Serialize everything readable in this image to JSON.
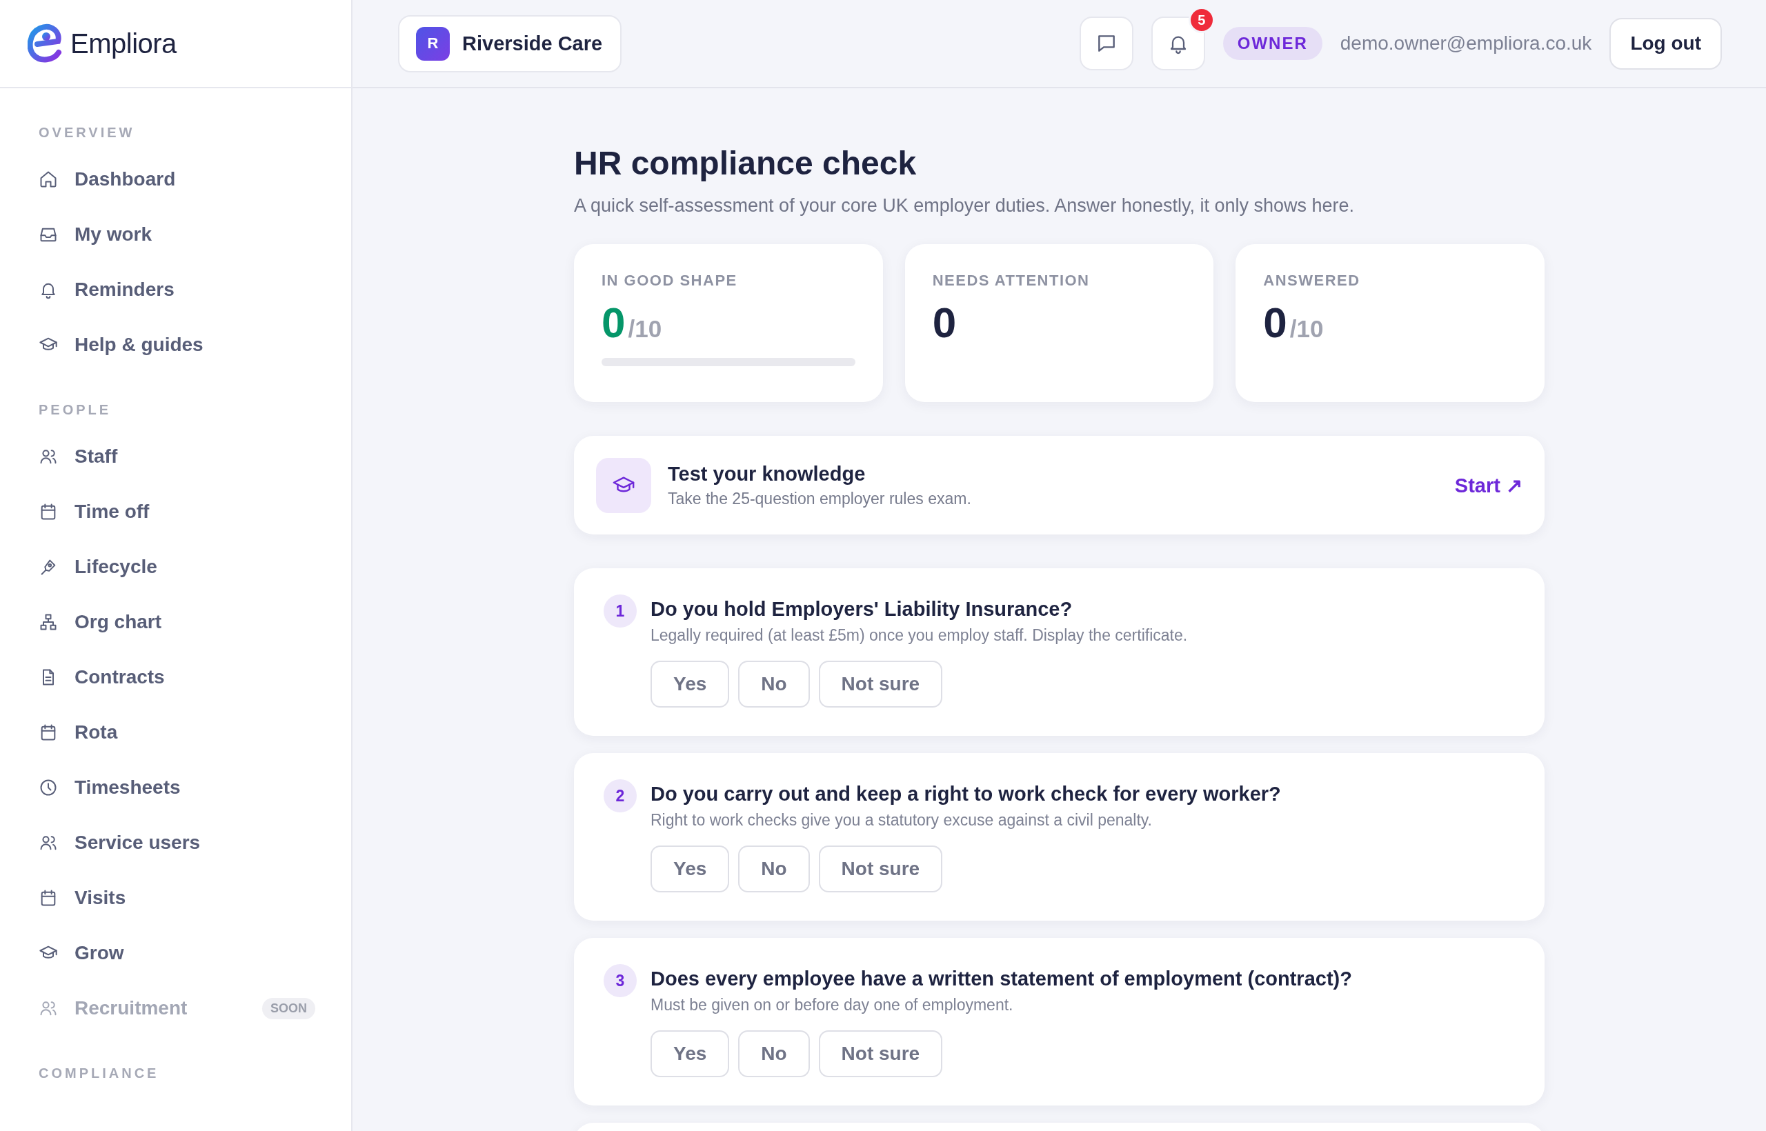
{
  "brand": {
    "name": "Empliora"
  },
  "sidebar": {
    "sections": [
      {
        "label": "OVERVIEW",
        "items": [
          {
            "label": "Dashboard",
            "disabled": false
          },
          {
            "label": "My work",
            "disabled": false
          },
          {
            "label": "Reminders",
            "disabled": false
          },
          {
            "label": "Help & guides",
            "disabled": false
          }
        ]
      },
      {
        "label": "PEOPLE",
        "items": [
          {
            "label": "Staff",
            "disabled": false
          },
          {
            "label": "Time off",
            "disabled": false
          },
          {
            "label": "Lifecycle",
            "disabled": false
          },
          {
            "label": "Org chart",
            "disabled": false
          },
          {
            "label": "Contracts",
            "disabled": false
          },
          {
            "label": "Rota",
            "disabled": false
          },
          {
            "label": "Timesheets",
            "disabled": false
          },
          {
            "label": "Service users",
            "disabled": false
          },
          {
            "label": "Visits",
            "disabled": false
          },
          {
            "label": "Grow",
            "disabled": false
          },
          {
            "label": "Recruitment",
            "disabled": true,
            "badge": "SOON"
          }
        ]
      },
      {
        "label": "COMPLIANCE"
      }
    ]
  },
  "topbar": {
    "org": {
      "initial": "R",
      "name": "Riverside Care"
    },
    "notification_count": "5",
    "role": "OWNER",
    "email": "demo.owner@empliora.co.uk",
    "logout": "Log out"
  },
  "page": {
    "title": "HR compliance check",
    "subtitle": "A quick self-assessment of your core UK employer duties. Answer honestly, it only shows here."
  },
  "stats": [
    {
      "label": "IN GOOD SHAPE",
      "value": "0",
      "total": "/10",
      "kind": "good",
      "level": 0
    },
    {
      "label": "NEEDS ATTENTION",
      "value": "0",
      "kind": "plain"
    },
    {
      "label": "ANSWERED",
      "value": "0",
      "total": "/10",
      "kind": "plain"
    }
  ],
  "quiz_card": {
    "title": "Test your knowledge",
    "description": "Take the 25-question employer rules exam.",
    "action": "Start ↗"
  },
  "questions": [
    {
      "number": "1",
      "title": "Do you hold Employers' Liability Insurance?",
      "description": "Legally required (at least £5m) once you employ staff. Display the certificate.",
      "options": [
        {
          "label": "Yes",
          "selected": false
        },
        {
          "label": "No",
          "selected": false
        },
        {
          "label": "Not sure",
          "selected": false
        }
      ]
    },
    {
      "number": "2",
      "title": "Do you carry out and keep a right to work check for every worker?",
      "description": "Right to work checks give you a statutory excuse against a civil penalty.",
      "options": [
        {
          "label": "Yes",
          "selected": false
        },
        {
          "label": "No",
          "selected": false
        },
        {
          "label": "Not sure",
          "selected": false
        }
      ]
    },
    {
      "number": "3",
      "title": "Does every employee have a written statement of employment (contract)?",
      "description": "Must be given on or before day one of employment.",
      "options": [
        {
          "label": "Yes",
          "selected": false
        },
        {
          "label": "No",
          "selected": false
        },
        {
          "label": "Not sure",
          "selected": false
        }
      ]
    },
    {
      "kind": "cut"
    }
  ]
}
